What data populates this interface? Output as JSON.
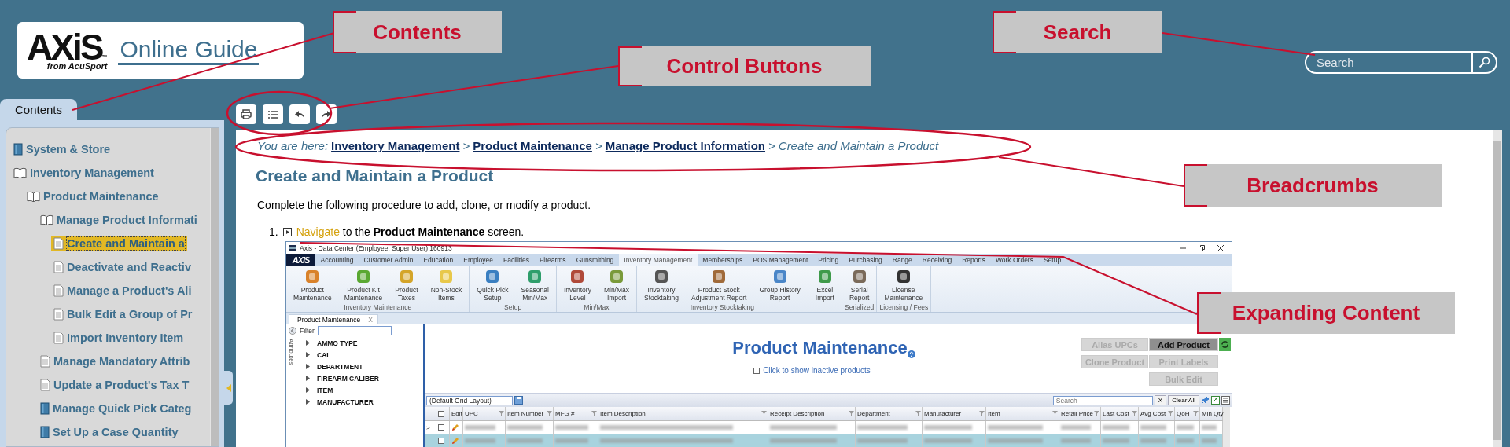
{
  "logo": {
    "brand": "AXiS",
    "trademark": "™",
    "tagline": "from AcuSport",
    "title": "Online Guide"
  },
  "search": {
    "placeholder": "Search"
  },
  "contents_tab": {
    "label": "Contents"
  },
  "sidebar": {
    "items": [
      {
        "label": "System & Store",
        "kind": "book",
        "expanded": false,
        "selected": false
      },
      {
        "label": "Inventory Management",
        "kind": "book",
        "expanded": true,
        "selected": false,
        "children": [
          {
            "label": "Product Maintenance",
            "kind": "book",
            "expanded": true,
            "selected": false,
            "children": [
              {
                "label": "Manage Product Informati",
                "kind": "book",
                "expanded": true,
                "selected": false,
                "children": [
                  {
                    "label": "Create and Maintain a",
                    "kind": "page",
                    "selected": true
                  },
                  {
                    "label": "Deactivate and Reactiv",
                    "kind": "page",
                    "selected": false
                  },
                  {
                    "label": "Manage a Product's Ali",
                    "kind": "page",
                    "selected": false
                  },
                  {
                    "label": "Bulk Edit a Group of Pr",
                    "kind": "page",
                    "selected": false
                  },
                  {
                    "label": "Import Inventory Item",
                    "kind": "page",
                    "selected": false
                  }
                ]
              },
              {
                "label": "Manage Mandatory Attrib",
                "kind": "page",
                "selected": false
              },
              {
                "label": "Update a Product's Tax T",
                "kind": "page",
                "selected": false
              },
              {
                "label": "Manage Quick Pick Categ",
                "kind": "book",
                "expanded": false,
                "selected": false
              },
              {
                "label": "Set Up a Case Quantity",
                "kind": "book",
                "expanded": false,
                "selected": false
              }
            ]
          }
        ]
      }
    ]
  },
  "control_buttons": [
    {
      "kind": "print"
    },
    {
      "kind": "list"
    },
    {
      "kind": "back"
    },
    {
      "kind": "forward"
    }
  ],
  "breadcrumb": {
    "prefix": "You are here:",
    "items": [
      {
        "label": "Inventory Management",
        "kind": "link"
      },
      {
        "separator": ">",
        "label": "Product Maintenance",
        "kind": "link"
      },
      {
        "separator": ">",
        "label": "Manage Product Information",
        "kind": "link"
      },
      {
        "separator": ">",
        "label": "Create and Maintain a Product",
        "kind": "current"
      }
    ]
  },
  "heading": "Create and Maintain a Product",
  "intro": "Complete the following procedure to add, clone, or modify a product.",
  "steps": [
    {
      "number": "1.",
      "link": "Navigate",
      "text": " to the **Product Maintenance** screen."
    }
  ],
  "app_window": {
    "title": "Axis - Data Center  (Employee: Super User) 160913",
    "logo": "AXIS",
    "menu_tabs": [
      {
        "label": "Accounting",
        "selected": false
      },
      {
        "label": "Customer Admin",
        "selected": false
      },
      {
        "label": "Education",
        "selected": false
      },
      {
        "label": "Employee",
        "selected": false
      },
      {
        "label": "Facilities",
        "selected": false
      },
      {
        "label": "Firearms",
        "selected": false
      },
      {
        "label": "Gunsmithing",
        "selected": false
      },
      {
        "label": "Inventory Management",
        "selected": true
      },
      {
        "label": "Memberships",
        "selected": false
      },
      {
        "label": "POS Management",
        "selected": false
      },
      {
        "label": "Pricing",
        "selected": false
      },
      {
        "label": "Purchasing",
        "selected": false
      },
      {
        "label": "Range",
        "selected": false
      },
      {
        "label": "Receiving",
        "selected": false
      },
      {
        "label": "Reports",
        "selected": false
      },
      {
        "label": "Work Orders",
        "selected": false
      },
      {
        "label": "Setup",
        "selected": false
      }
    ],
    "ribbon_groups": [
      {
        "label": "Inventory Maintenance",
        "items": [
          "Product\nMaintenance",
          "Product Kit\nMaintenance",
          "Product\nTaxes",
          "Non-Stock\nItems"
        ]
      },
      {
        "label": "Setup",
        "items": [
          "Quick Pick\nSetup",
          "Seasonal\nMin/Max"
        ]
      },
      {
        "label": "Min/Max",
        "items": [
          "Inventory\nLevel",
          "Min/Max\nImport"
        ]
      },
      {
        "label": "Inventory Stocktaking",
        "items": [
          "Inventory\nStocktaking",
          "Product Stock\nAdjustment Report",
          "Group History\nReport"
        ]
      },
      {
        "items": [
          "Excel\nImport"
        ]
      },
      {
        "label": "Serialized",
        "items": [
          "Serial\nReport"
        ]
      },
      {
        "label": "Licensing / Fees",
        "items": [
          "License\nMaintenance"
        ]
      }
    ],
    "doc_tabs": [
      {
        "label": "Product Maintenance",
        "close": "X",
        "selected": true
      }
    ],
    "filter": {
      "label": "Filter"
    },
    "attributes_label": "Attributes",
    "attributes": [
      {
        "label": "AMMO TYPE",
        "expanded": false
      },
      {
        "label": "CAL",
        "expanded": false
      },
      {
        "label": "DEPARTMENT",
        "expanded": false
      },
      {
        "label": "FIREARM CALIBER",
        "expanded": false
      },
      {
        "label": "ITEM",
        "expanded": false
      },
      {
        "label": "MANUFACTURER",
        "expanded": false
      }
    ],
    "page_title": "Product Maintenance",
    "inactive_toggle": {
      "label": "Click to show inactive products",
      "checked": false
    },
    "buttons": [
      {
        "label": "Alias UPCs",
        "disabled": true
      },
      {
        "label": "Add Product",
        "disabled": false
      },
      {
        "label": "Clone Product",
        "disabled": true
      },
      {
        "label": "Print Labels",
        "disabled": true
      },
      {
        "label": "Bulk Edit",
        "disabled": true
      }
    ],
    "grid_layout": "(Default Grid Layout)",
    "grid_search": {
      "placeholder": "Search"
    },
    "clear_x": "X",
    "clear_all": "Clear All",
    "select_all_checked": false,
    "columns": [
      {
        "label": "Edit",
        "filter": false
      },
      {
        "label": "UPC",
        "filter": true
      },
      {
        "label": "Item Number",
        "filter": true
      },
      {
        "label": "MFG #",
        "filter": true
      },
      {
        "label": "Item Description",
        "filter": true
      },
      {
        "label": "Receipt Description",
        "filter": true
      },
      {
        "label": "Department",
        "filter": true
      },
      {
        "label": "Manufacturer",
        "filter": true
      },
      {
        "label": "Item",
        "filter": true
      },
      {
        "label": "Retail Price",
        "filter": true
      },
      {
        "label": "Last Cost",
        "filter": true
      },
      {
        "label": "Avg Cost",
        "filter": true
      },
      {
        "label": "QoH",
        "filter": true
      },
      {
        "label": "Min Qty",
        "filter": false
      }
    ],
    "rows": [
      {
        "indicator": ">",
        "selected": false,
        "checked": false
      },
      {
        "selected": true,
        "checked": false
      }
    ]
  },
  "annotations": [
    {
      "label": "Contents"
    },
    {
      "label": "Control Buttons"
    },
    {
      "label": "Search"
    },
    {
      "label": "Breadcrumbs"
    },
    {
      "label": "Expanding Content"
    }
  ]
}
